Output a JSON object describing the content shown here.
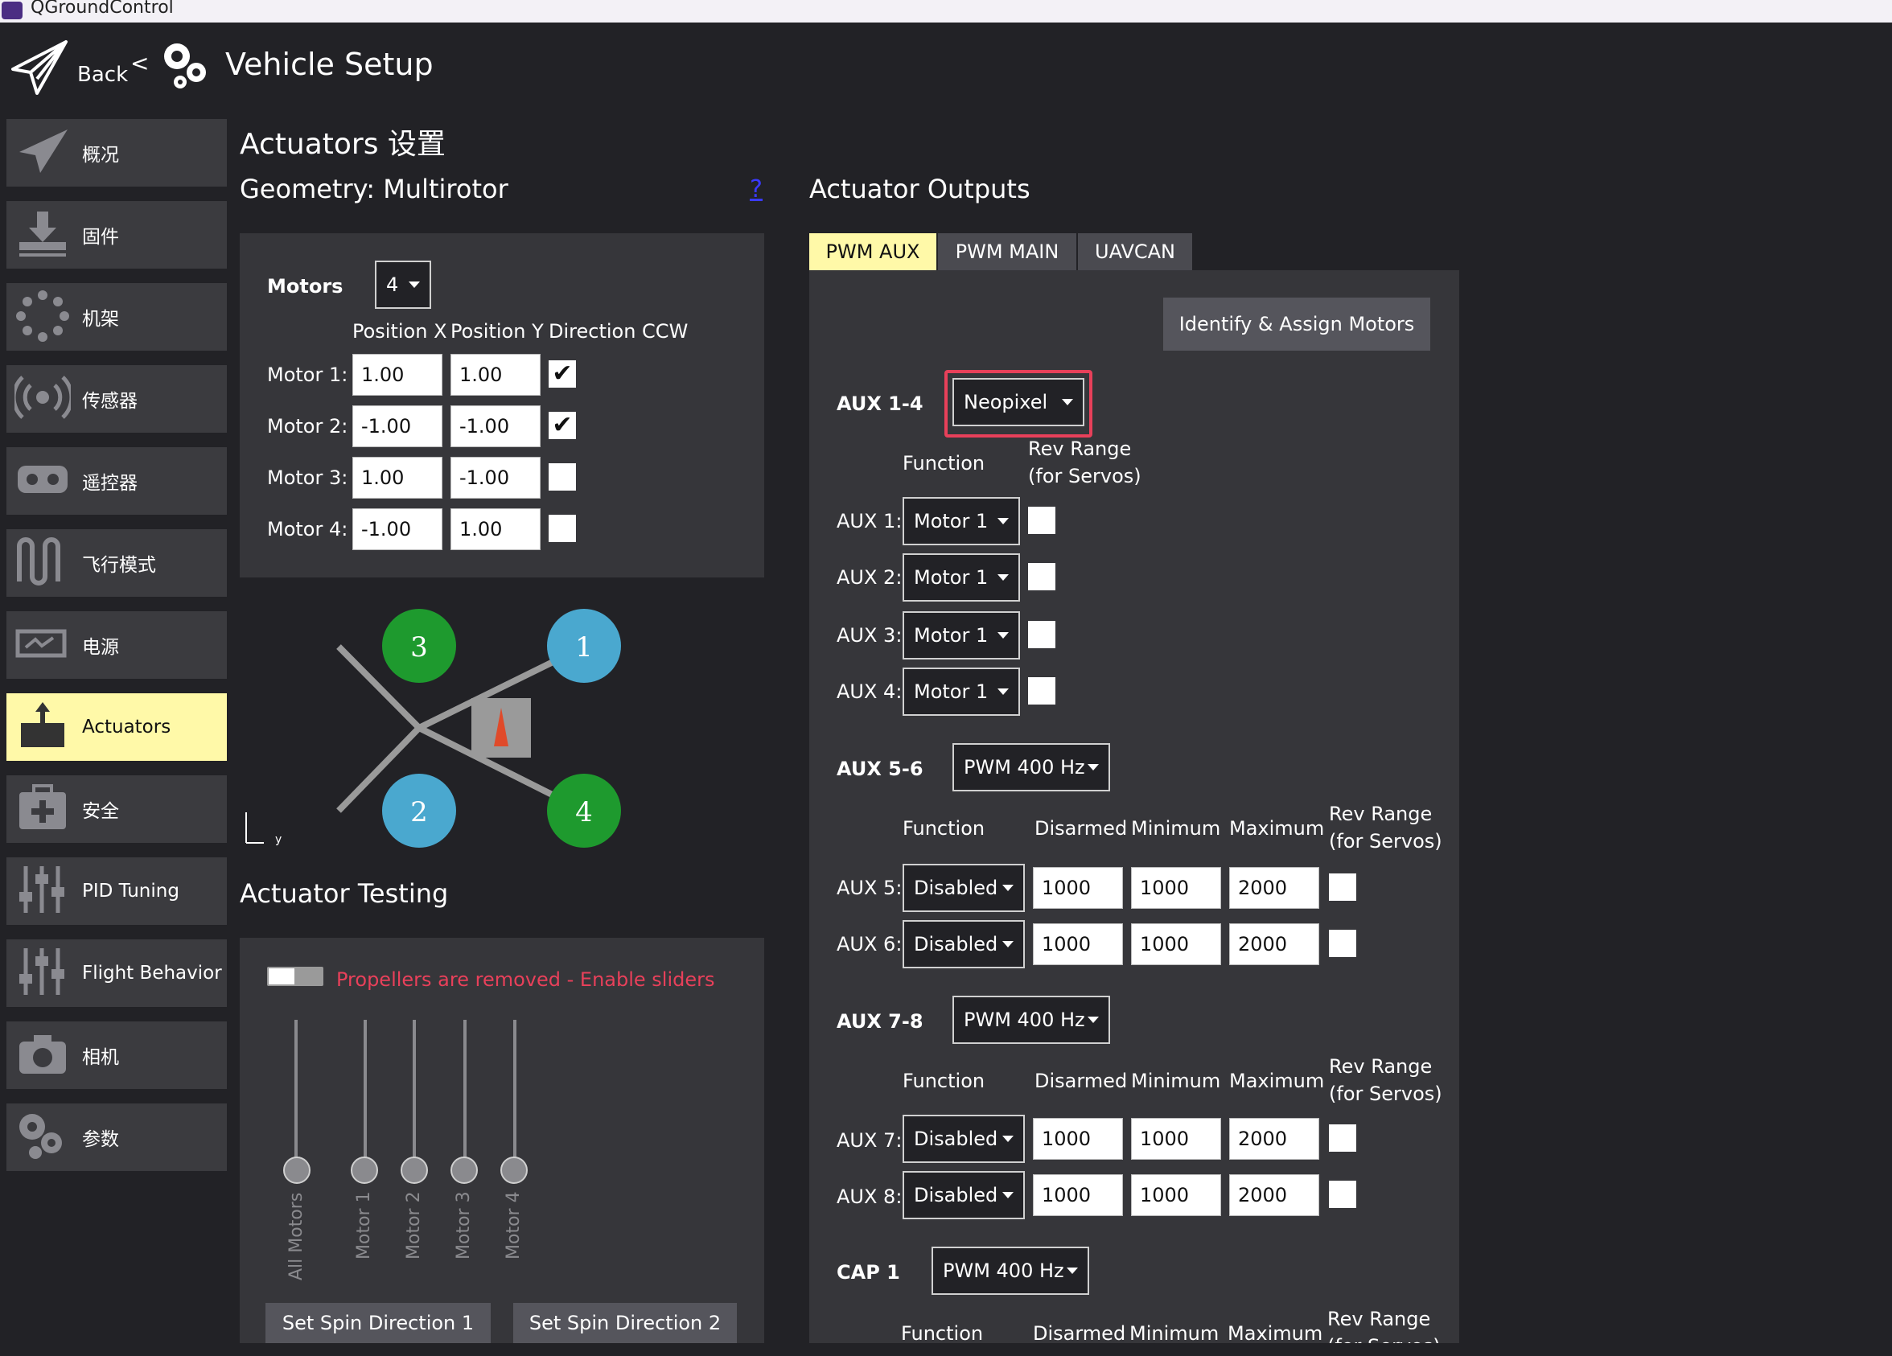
{
  "window": {
    "title": "QGroundControl"
  },
  "header": {
    "back_label": "Back",
    "separator": "<",
    "title": "Vehicle Setup"
  },
  "sidebar": {
    "items": [
      {
        "label": "概况",
        "icon": "paper-plane-icon"
      },
      {
        "label": "固件",
        "icon": "download-icon"
      },
      {
        "label": "机架",
        "icon": "airframe-icon"
      },
      {
        "label": "传感器",
        "icon": "radio-waves-icon"
      },
      {
        "label": "遥控器",
        "icon": "gamepad-icon"
      },
      {
        "label": "飞行模式",
        "icon": "wave-icon"
      },
      {
        "label": "电源",
        "icon": "battery-icon"
      },
      {
        "label": "Actuators",
        "icon": "actuator-icon",
        "active": true
      },
      {
        "label": "安全",
        "icon": "medkit-icon"
      },
      {
        "label": "PID Tuning",
        "icon": "sliders-icon"
      },
      {
        "label": "Flight Behavior",
        "icon": "sliders-icon"
      },
      {
        "label": "相机",
        "icon": "camera-icon"
      },
      {
        "label": "参数",
        "icon": "gears-icon"
      }
    ]
  },
  "page": {
    "title": "Actuators 设置"
  },
  "geometry": {
    "title": "Geometry: Multirotor",
    "help": "?",
    "motors_label": "Motors",
    "motors_count": "4",
    "col_headers": [
      "Position X",
      "Position Y",
      "Direction CCW"
    ],
    "rows": [
      {
        "label": "Motor 1:",
        "x": "1.00",
        "y": "1.00",
        "ccw": true
      },
      {
        "label": "Motor 2:",
        "x": "-1.00",
        "y": "-1.00",
        "ccw": true
      },
      {
        "label": "Motor 3:",
        "x": "1.00",
        "y": "-1.00",
        "ccw": false
      },
      {
        "label": "Motor 4:",
        "x": "-1.00",
        "y": "1.00",
        "ccw": false
      }
    ],
    "diagram_motors": [
      "3",
      "1",
      "2",
      "4"
    ],
    "axis_label": "y"
  },
  "testing": {
    "title": "Actuator Testing",
    "warning": "Propellers are removed - Enable sliders",
    "sliders": [
      "All Motors",
      "Motor 1",
      "Motor 2",
      "Motor 3",
      "Motor 4"
    ],
    "spin1": "Set Spin Direction 1",
    "spin2": "Set Spin Direction 2"
  },
  "outputs": {
    "title": "Actuator Outputs",
    "tabs": [
      "PWM AUX",
      "PWM MAIN",
      "UAVCAN"
    ],
    "identify_button": "Identify & Assign Motors",
    "group1": {
      "label": "AUX 1-4",
      "protocol": "Neopixel",
      "h_function": "Function",
      "h_rev1": "Rev Range",
      "h_rev2": "(for Servos)",
      "rows": [
        {
          "label": "AUX 1:",
          "function": "Motor 1"
        },
        {
          "label": "AUX 2:",
          "function": "Motor 1"
        },
        {
          "label": "AUX 3:",
          "function": "Motor 1"
        },
        {
          "label": "AUX 4:",
          "function": "Motor 1"
        }
      ]
    },
    "headers": {
      "function": "Function",
      "disarmed": "Disarmed",
      "minimum": "Minimum",
      "maximum": "Maximum",
      "rev1": "Rev Range",
      "rev2": "(for Servos)"
    },
    "group2": {
      "label": "AUX 5-6",
      "protocol": "PWM 400 Hz",
      "rows": [
        {
          "label": "AUX 5:",
          "function": "Disabled",
          "disarmed": "1000",
          "min": "1000",
          "max": "2000"
        },
        {
          "label": "AUX 6:",
          "function": "Disabled",
          "disarmed": "1000",
          "min": "1000",
          "max": "2000"
        }
      ]
    },
    "group3": {
      "label": "AUX 7-8",
      "protocol": "PWM 400 Hz",
      "rows": [
        {
          "label": "AUX 7:",
          "function": "Disabled",
          "disarmed": "1000",
          "min": "1000",
          "max": "2000"
        },
        {
          "label": "AUX 8:",
          "function": "Disabled",
          "disarmed": "1000",
          "min": "1000",
          "max": "2000"
        }
      ]
    },
    "group4": {
      "label": "CAP 1",
      "protocol": "PWM 400 Hz"
    }
  },
  "colors": {
    "accent": "#fff9a8",
    "highlight_box": "#e8405a",
    "warning_text": "#e8405a",
    "motor_green": "#1e9a2e",
    "motor_blue": "#4aa8cf"
  }
}
